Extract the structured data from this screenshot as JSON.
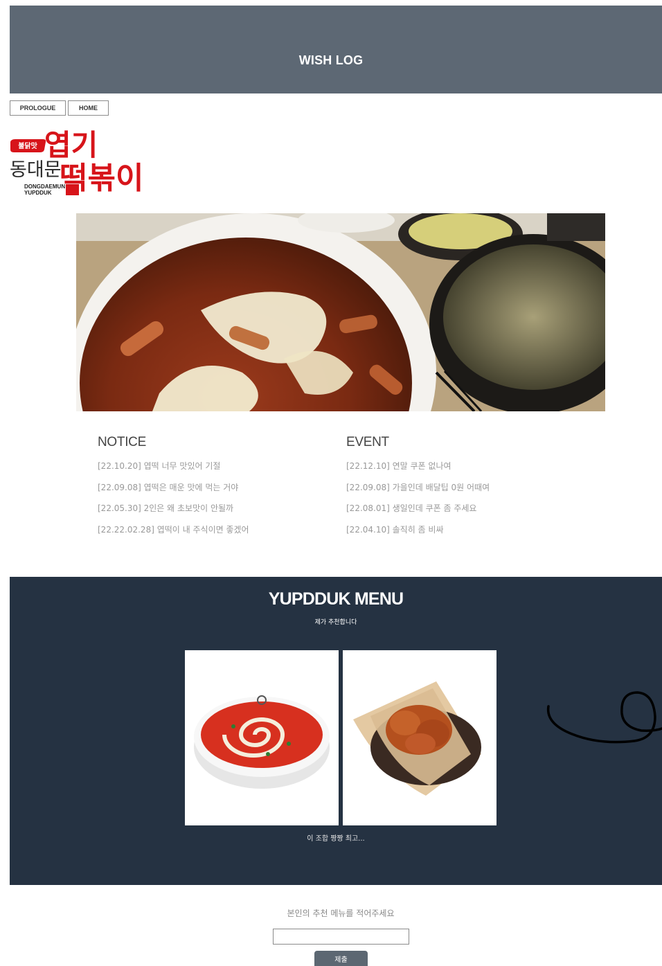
{
  "header": {
    "title": "WISH LOG"
  },
  "nav": {
    "prologue_label": "PROLOGUE",
    "home_label": "HOME"
  },
  "logo": {
    "badge": "불닭맛",
    "line1": "엽기",
    "line2": "동대문",
    "line3": "떡볶이",
    "english_line1": "DONGDAEMUN",
    "english_line2": "YUPDDUK"
  },
  "notice": {
    "title": "NOTICE",
    "items": [
      "[22.10.20] 엽떡 너무 맛있어 기절",
      "[22.09.08] 엽떡은 매운 맛에 먹는 거야",
      "[22.05.30] 2인은 왜 초보맛이 안될까",
      "[22.22.02.28] 엽떡이 내 주식이면 좋겠어"
    ]
  },
  "event": {
    "title": "EVENT",
    "items": [
      "[22.12.10] 연말 쿠폰 없나여",
      "[22.09.08] 가을인데 배달팁 0원 어때여",
      "[22.08.01] 생일인데 쿠폰 좀 주세요",
      "[22.04.10] 솔직히 좀 비싸"
    ]
  },
  "menu": {
    "title": "YUPDDUK MENU",
    "subtitle": "제가 추천합니다",
    "caption": "이 조합 짱짱 최고..."
  },
  "form": {
    "label": "본인의 추천 메뉴를 적어주세요",
    "input_value": "",
    "submit_label": "제출"
  },
  "colors": {
    "header_bg": "#5d6874",
    "menu_bg": "#253242",
    "brand_red": "#d7141a",
    "submit_bg": "#5c6772"
  }
}
